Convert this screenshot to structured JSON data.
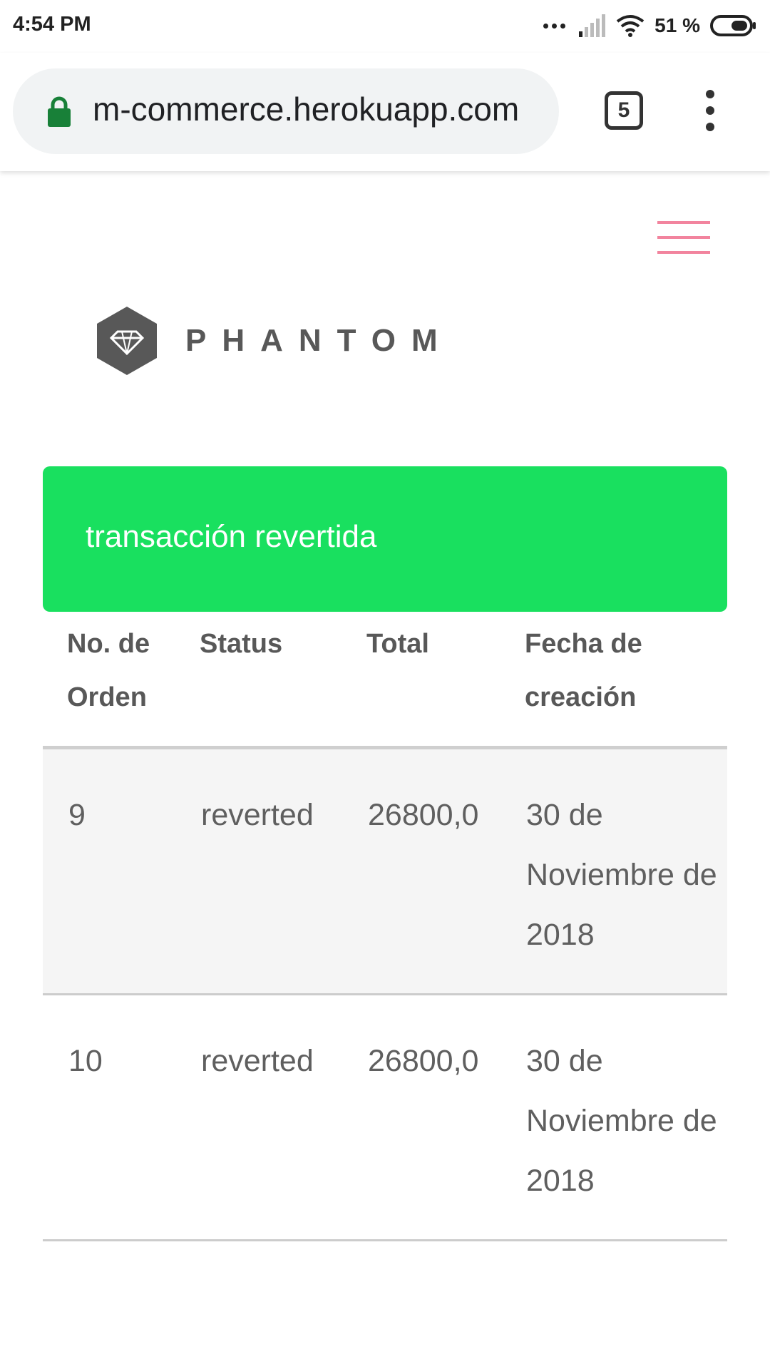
{
  "status_bar": {
    "time": "4:54 PM",
    "battery": "51 %"
  },
  "browser": {
    "url": "m-commerce.herokuapp.com",
    "tab_count": "5"
  },
  "brand": {
    "name": "PHANTOM",
    "hamburger_color": "#f2849e"
  },
  "alert": {
    "message": "transacción revertida",
    "color": "#19e05f"
  },
  "table": {
    "headers": [
      "No. de Orden",
      "Status",
      "Total",
      "Fecha de creación"
    ],
    "rows": [
      [
        "9",
        "reverted",
        "26800,0",
        "30 de Noviembre de 2018"
      ],
      [
        "10",
        "reverted",
        "26800,0",
        "30 de Noviembre de 2018"
      ]
    ]
  }
}
